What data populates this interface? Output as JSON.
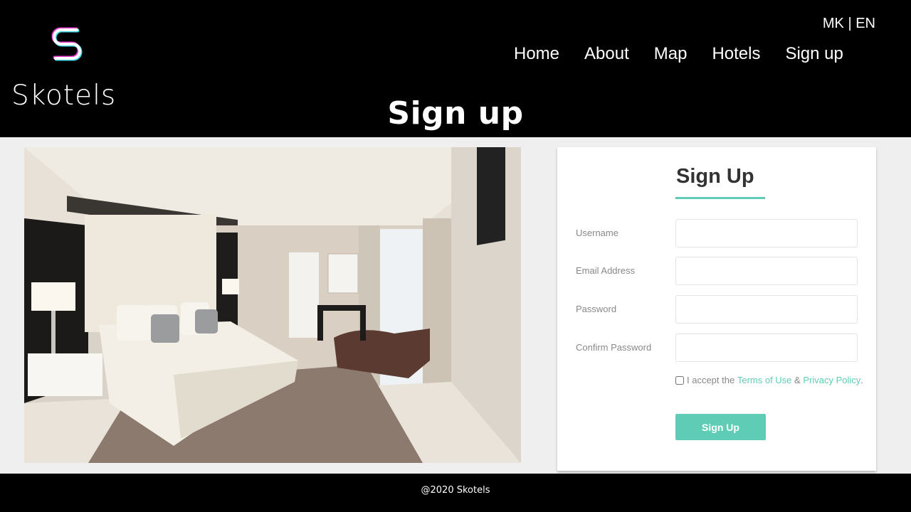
{
  "brand": {
    "name": "Skotels",
    "logo_icon": "s-logo-icon"
  },
  "language": {
    "mk": "MK",
    "separator": "|",
    "en": "EN"
  },
  "nav": {
    "items": [
      "Home",
      "About",
      "Map",
      "Hotels",
      "Sign up"
    ]
  },
  "page_title": "Sign up",
  "photo": {
    "subject": "hotel bedroom"
  },
  "form": {
    "title": "Sign Up",
    "fields": [
      {
        "label": "Username",
        "value": "",
        "placeholder": ""
      },
      {
        "label": "Email Address",
        "value": "",
        "placeholder": ""
      },
      {
        "label": "Password",
        "value": "",
        "placeholder": ""
      },
      {
        "label": "Confirm Password",
        "value": "",
        "placeholder": ""
      }
    ],
    "terms_prefix": "I accept the",
    "terms_link": "Terms of Use",
    "terms_and": "&",
    "privacy_link": "Privacy Policy",
    "terms_suffix": ".",
    "submit_label": "Sign Up"
  },
  "footer": {
    "text": "@2020 Skotels"
  },
  "colors": {
    "accent": "#5fcdb5",
    "header_bg": "#000000",
    "main_bg": "#efefef"
  }
}
